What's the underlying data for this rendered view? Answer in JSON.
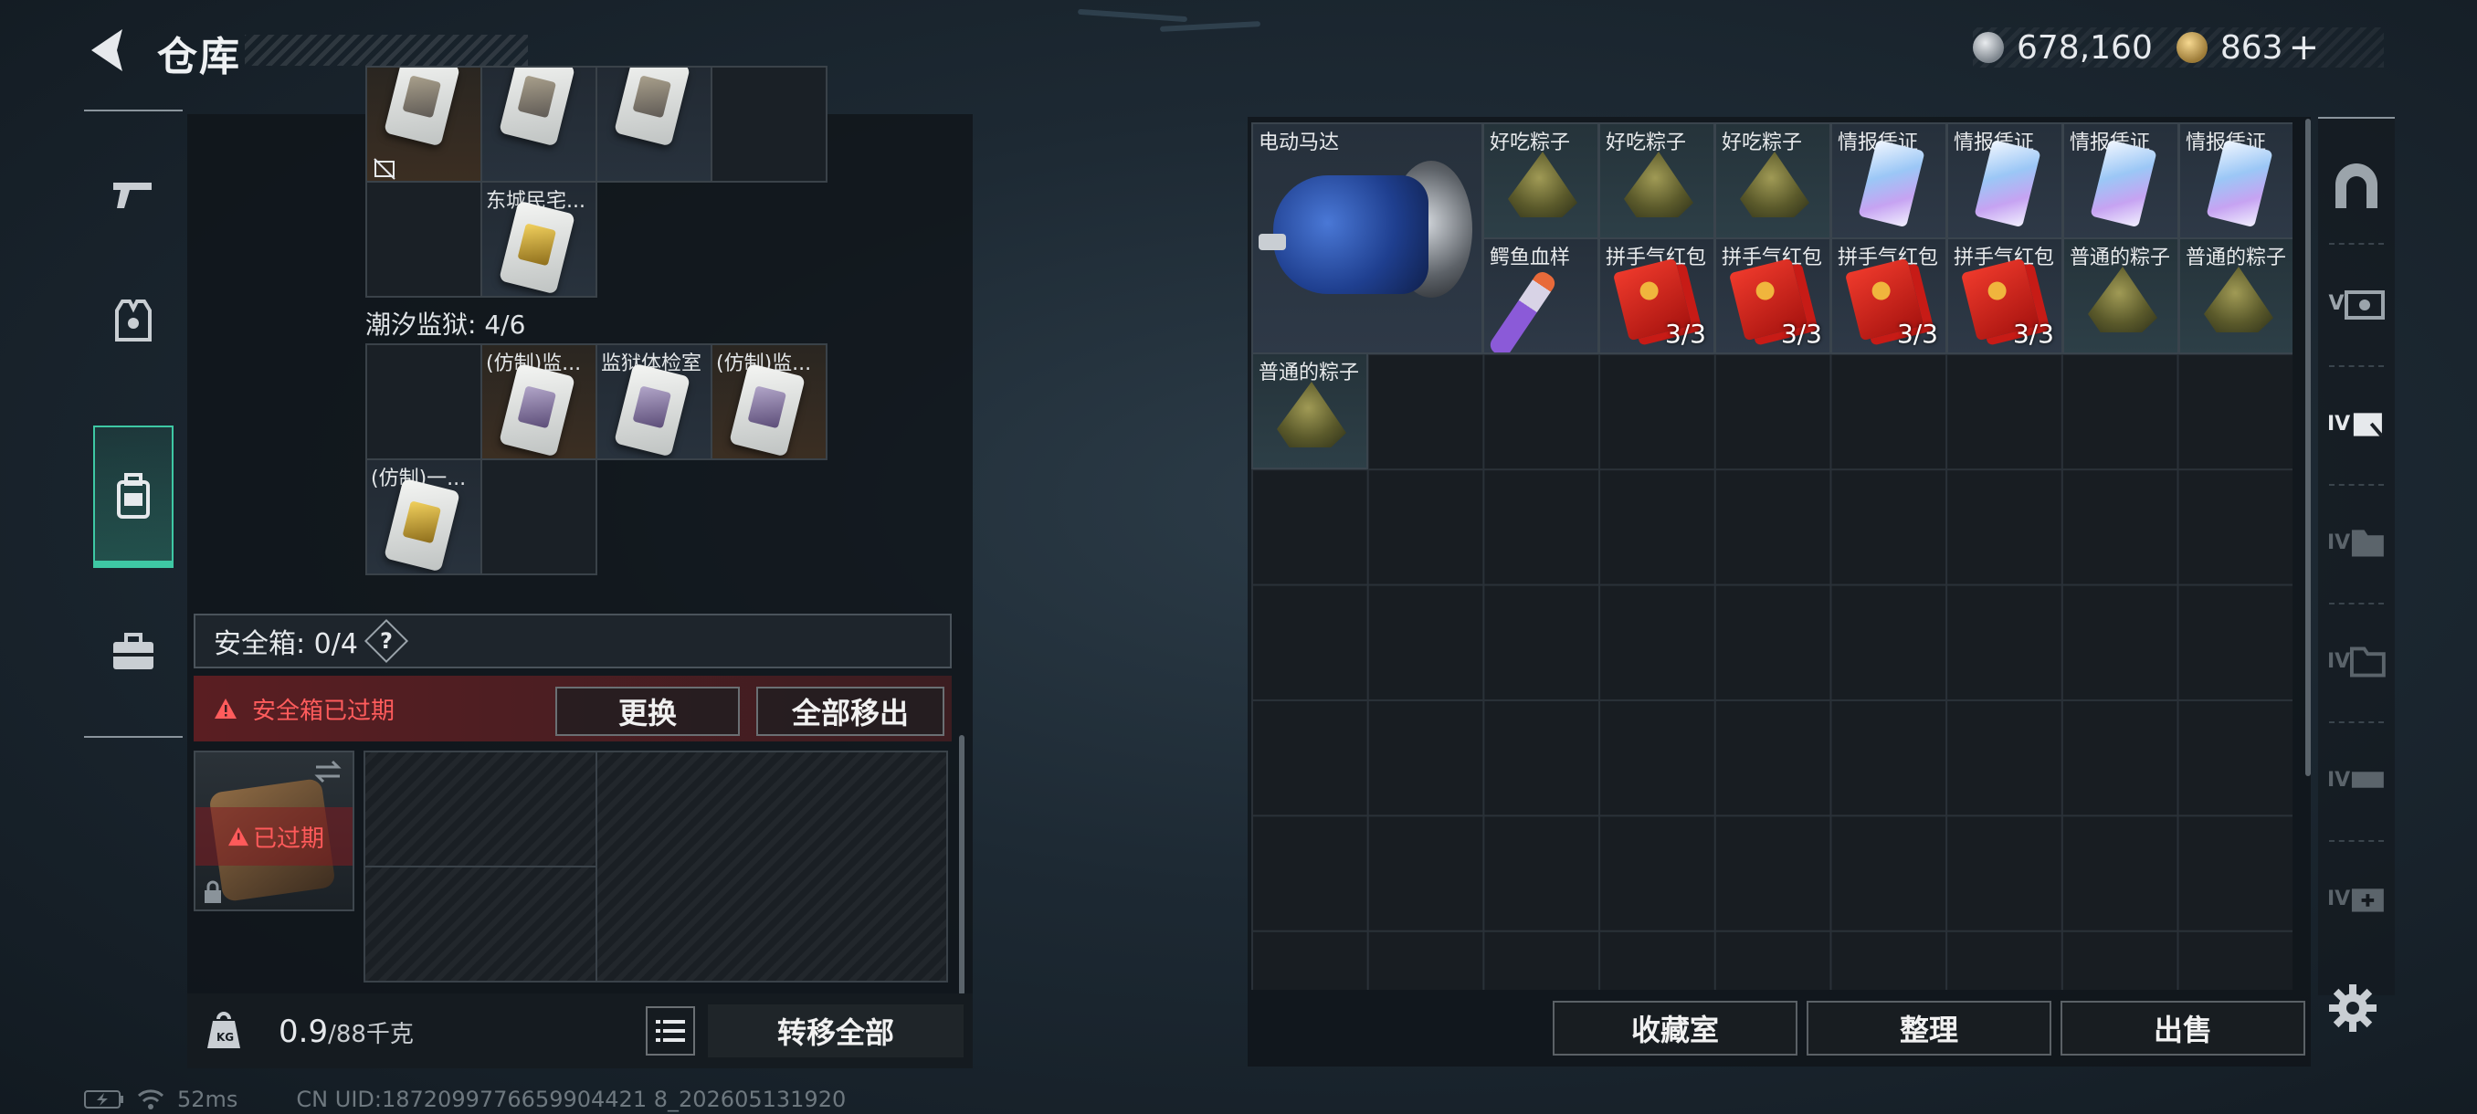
{
  "header": {
    "title": "仓库",
    "silver_amount": "678,160",
    "gold_amount": "863",
    "add_label": "+"
  },
  "left_nav": [
    {
      "name": "weapons",
      "icon": "gun-icon"
    },
    {
      "name": "armor",
      "icon": "vest-icon"
    },
    {
      "name": "backpack",
      "icon": "backpack-icon",
      "active": true
    },
    {
      "name": "tools",
      "icon": "toolbox-icon"
    }
  ],
  "left_grid": {
    "row0": [
      {
        "label": ""
      },
      {
        "label": ""
      },
      {
        "label": ""
      },
      {
        "label": ""
      }
    ],
    "dongcheng_item": "东城民宅...",
    "section_title": "潮汐监狱: 4/6",
    "prison_items": [
      "(仿制)监...",
      "监狱体检室",
      "(仿制)监...",
      "(仿制)一..."
    ]
  },
  "safe": {
    "label": "安全箱: 0/4",
    "help": "?",
    "alert": "安全箱已过期",
    "replace_button": "更换",
    "move_all_button": "全部移出",
    "expired_label": "已过期"
  },
  "footer_left": {
    "weight_current": "0.9",
    "weight_max": "/88千克",
    "transfer_button": "转移全部"
  },
  "storage": {
    "motor": "电动马达",
    "row1": [
      "好吃粽子",
      "好吃粽子",
      "好吃粽子",
      "情报凭证",
      "情报凭证",
      "情报凭证",
      "情报凭证"
    ],
    "row2": [
      "鳄鱼血样",
      "拼手气红包",
      "拼手气红包",
      "拼手气红包",
      "拼手气红包",
      "普通的粽子",
      "普通的粽子"
    ],
    "row2_counts": [
      "",
      "3/3",
      "3/3",
      "3/3",
      "3/3",
      "",
      ""
    ],
    "row3": [
      "普通的粽子"
    ]
  },
  "footer_right": {
    "collection_button": "收藏室",
    "sort_button": "整理",
    "sell_button": "出售"
  },
  "status": {
    "ping": "52ms",
    "uid": "CN UID:1872099776659904421 8_202605131920"
  },
  "colors": {
    "accent": "#3ec8a4",
    "alert": "#ff5c5c"
  }
}
